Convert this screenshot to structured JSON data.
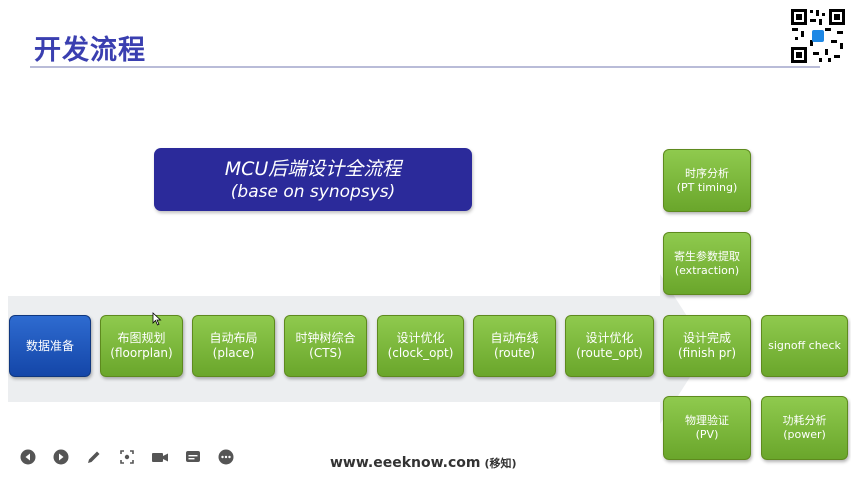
{
  "title": "开发流程",
  "banner": {
    "line1": "MCU后端设计全流程",
    "line2": "(base on synopsys)"
  },
  "flow": [
    {
      "l1": "数据准备",
      "l2": ""
    },
    {
      "l1": "布图规划",
      "l2": "(floorplan)"
    },
    {
      "l1": "自动布局",
      "l2": "(place)"
    },
    {
      "l1": "时钟树综合",
      "l2": "(CTS)"
    },
    {
      "l1": "设计优化",
      "l2": "(clock_opt)"
    },
    {
      "l1": "自动布线",
      "l2": "(route)"
    },
    {
      "l1": "设计优化",
      "l2": "(route_opt)"
    },
    {
      "l1": "设计完成",
      "l2": "(finish pr)"
    },
    {
      "l1": "signoff check",
      "l2": ""
    }
  ],
  "upper": [
    {
      "l1": "时序分析",
      "l2": "(PT timing)"
    },
    {
      "l1": "寄生参数提取",
      "l2": "(extraction)"
    }
  ],
  "lower": [
    {
      "l1": "物理验证",
      "l2": "(PV)"
    },
    {
      "l1": "功耗分析",
      "l2": "(power)"
    }
  ],
  "footer": {
    "url": "www.eeeknow.com",
    "sub": "(移知)"
  },
  "toolbar_icons": [
    "prev-icon",
    "next-icon",
    "pen-icon",
    "zoom-icon",
    "camera-icon",
    "subtitles-icon",
    "more-icon"
  ],
  "colors": {
    "green": "#7ab83a",
    "blue": "#1a55bd",
    "banner": "#2b2a9a",
    "title": "#3a3fb0"
  }
}
